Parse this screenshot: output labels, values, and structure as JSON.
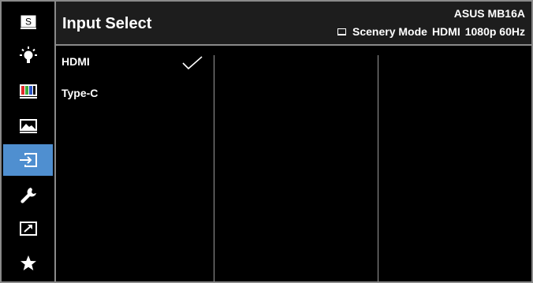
{
  "sidebar": {
    "items": [
      {
        "id": "splendid",
        "icon": "splendid-s-icon",
        "label": "S"
      },
      {
        "id": "blue-light",
        "icon": "blue-light-filter-icon"
      },
      {
        "id": "color",
        "icon": "color-bars-icon"
      },
      {
        "id": "image",
        "icon": "image-icon"
      },
      {
        "id": "input-select",
        "icon": "input-select-icon",
        "active": true
      },
      {
        "id": "system-setup",
        "icon": "wrench-icon"
      },
      {
        "id": "shortcut",
        "icon": "shortcut-arrow-icon"
      },
      {
        "id": "myfavorite",
        "icon": "star-icon"
      }
    ],
    "active_color": "#4f8fd0"
  },
  "header": {
    "title": "Input Select",
    "model": "ASUS MB16A",
    "mode": "Scenery Mode",
    "input": "HDMI",
    "resolution": "1080p 60Hz"
  },
  "options": [
    {
      "label": "HDMI",
      "selected": true
    },
    {
      "label": "Type-C",
      "selected": false
    }
  ]
}
